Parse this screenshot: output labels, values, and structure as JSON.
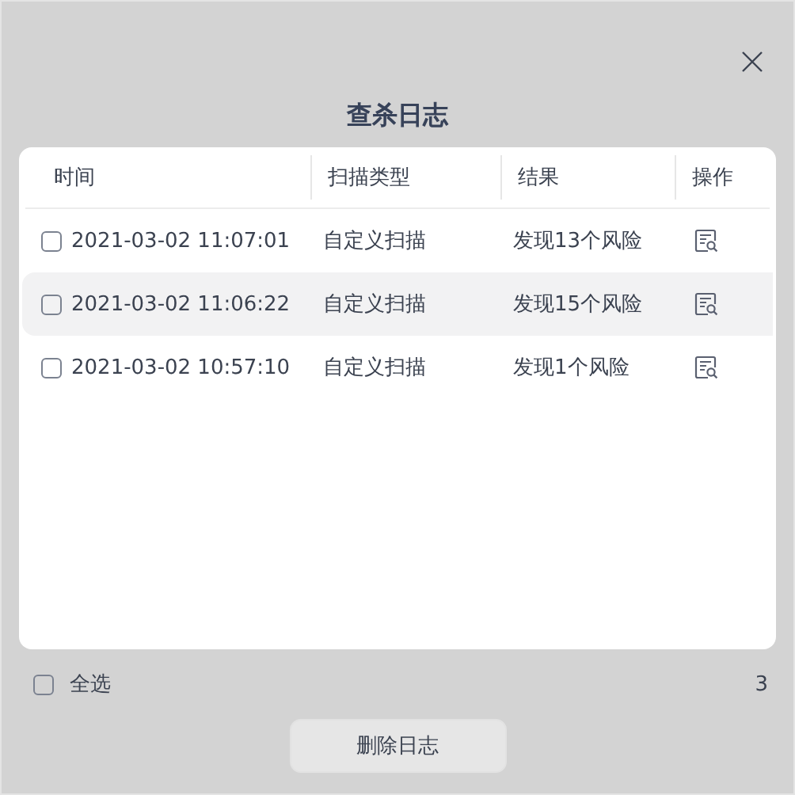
{
  "dialog": {
    "title": "查杀日志"
  },
  "table": {
    "columns": [
      "时间",
      "扫描类型",
      "结果",
      "操作"
    ],
    "rows": [
      {
        "checked": false,
        "selected": false,
        "time": "2021-03-02 11:07:01",
        "type": "自定义扫描",
        "result": "发现13个风险"
      },
      {
        "checked": false,
        "selected": true,
        "time": "2021-03-02 11:06:22",
        "type": "自定义扫描",
        "result": "发现15个风险"
      },
      {
        "checked": false,
        "selected": false,
        "time": "2021-03-02 10:57:10",
        "type": "自定义扫描",
        "result": "发现1个风险"
      }
    ]
  },
  "footer": {
    "select_all": {
      "label": "全选",
      "checked": false
    },
    "count": "3",
    "delete_button": "删除日志"
  }
}
